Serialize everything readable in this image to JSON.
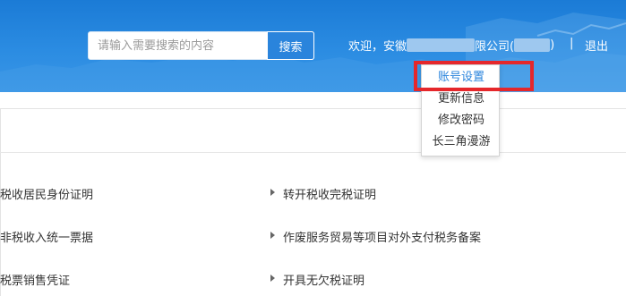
{
  "header": {
    "search": {
      "placeholder": "请输入需要搜索的内容",
      "button_label": "搜索"
    },
    "welcome_prefix": "欢迎，安徽",
    "welcome_company_suffix": "限公司(",
    "welcome_close": ")",
    "separator": "|",
    "logout_label": "退出"
  },
  "account_menu": {
    "items": [
      {
        "label": "账号设置"
      },
      {
        "label": "更新信息"
      },
      {
        "label": "修改密码"
      },
      {
        "label": "长三角漫游"
      }
    ]
  },
  "services": {
    "left": [
      {
        "label": "税收居民身份证明"
      },
      {
        "label": "非税收入统一票据"
      },
      {
        "label": "税票销售凭证"
      }
    ],
    "right": [
      {
        "label": "转开税收完税证明"
      },
      {
        "label": "作废服务贸易等项目对外支付税务备案"
      },
      {
        "label": "开具无欠税证明"
      }
    ]
  },
  "colors": {
    "accent": "#2a84dc",
    "highlight": "#e5272b",
    "header_bg": "#1b7bd6"
  }
}
